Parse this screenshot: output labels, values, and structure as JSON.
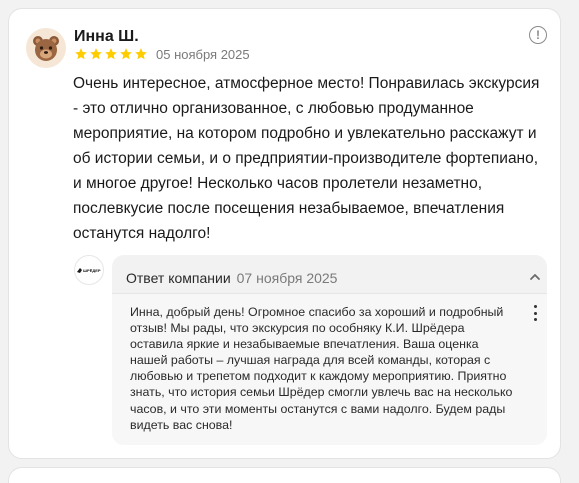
{
  "review": {
    "author": "Инна Ш.",
    "rating": 5,
    "rating_max": 5,
    "date": "05 ноября 2025",
    "text": "Очень интересное, атмосферное место! Понравилась экскурсия - это отлично организованное, с любовью продуманное мероприятие, на котором подробно и увлекательно расскажут и об истории семьи, и о предприятии-производителе фортепиано, и многое другое! Несколько часов пролетели незаметно, послевкусие после посещения незабываемое, впечатления останутся надолго!",
    "avatar_icon": "bear-emoji-icon",
    "star_color": "#ffcc00"
  },
  "reply": {
    "title": "Ответ компании",
    "date": "07 ноября 2025",
    "logo_text": "ШРЁДЕР",
    "text": "Инна, добрый день! Огромное спасибо за хороший и подробный отзыв! Мы рады, что экскурсия по особняку К.И. Шрёдера оставила яркие и незабываемые впечатления. Ваша оценка нашей работы – лучшая награда для всей команды, которая с любовью и трепетом подходит к каждому мероприятию. Приятно знать, что история семьи Шрёдер смогли увлечь вас на несколько часов, и что эти моменты останутся с вами надолго. Будем рады видеть вас снова!",
    "collapse_icon": "chevron-up-icon",
    "menu_icon": "more-vertical-icon"
  },
  "icons": {
    "info": "info-icon",
    "info_glyph": "!"
  }
}
